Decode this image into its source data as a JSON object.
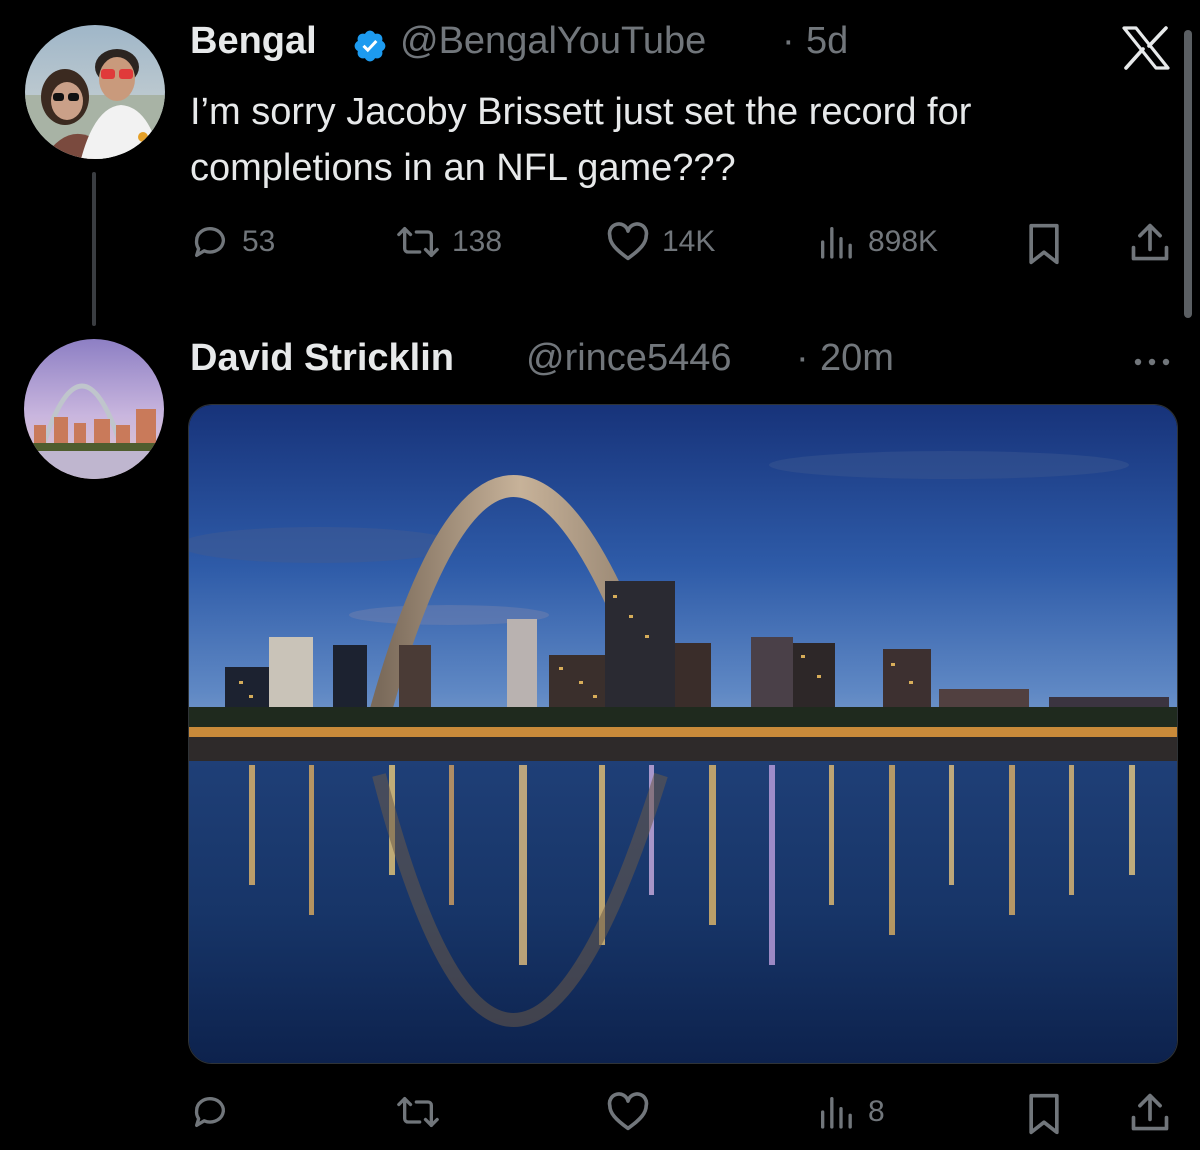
{
  "tweet1": {
    "name": "Bengal",
    "handle": "@BengalYouTube",
    "separator": "·",
    "time": "5d",
    "text": "I’m sorry Jacoby Brissett just set the record for completions in an NFL game???",
    "replies": "53",
    "reposts": "138",
    "likes": "14K",
    "views": "898K",
    "verified": true
  },
  "tweet2": {
    "name": "David Stricklin",
    "handle": "@rince5446",
    "separator": "·",
    "time": "20m",
    "views": "8"
  },
  "icons": {
    "verified": "verified-badge-icon",
    "x_logo": "x-logo-icon",
    "more": "more-dots-icon",
    "reply": "reply-icon",
    "repost": "repost-icon",
    "like": "heart-icon",
    "views": "views-bar-chart-icon",
    "bookmark": "bookmark-icon",
    "share": "share-icon"
  },
  "colors": {
    "background": "#000000",
    "text": "#e7e9ea",
    "secondary": "#71767b",
    "verified": "#1d9bf0"
  }
}
